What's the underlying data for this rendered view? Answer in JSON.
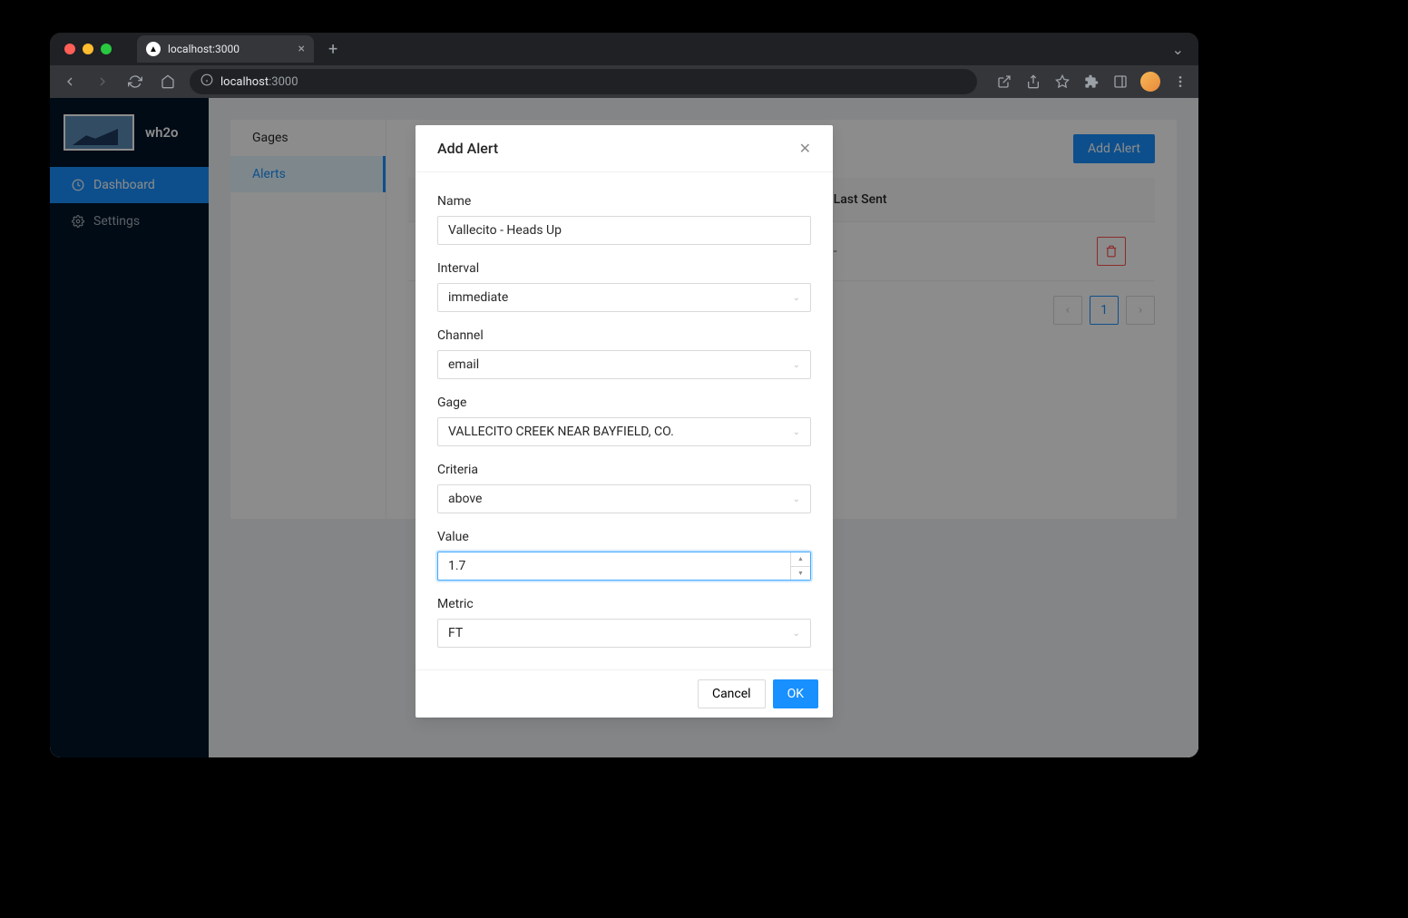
{
  "browser": {
    "tab_title": "localhost:3000",
    "url_prefix": "localhost",
    "url_suffix": ":3000"
  },
  "sidebar": {
    "app_name": "wh2o",
    "items": [
      {
        "label": "Dashboard"
      },
      {
        "label": "Settings"
      }
    ]
  },
  "tabs": {
    "items": [
      {
        "label": "Gages"
      },
      {
        "label": "Alerts"
      }
    ]
  },
  "panel": {
    "add_button": "Add Alert",
    "columns": {
      "last_sent": "Last Sent"
    },
    "rows": [
      {
        "last_sent": "-"
      }
    ],
    "page": "1"
  },
  "modal": {
    "title": "Add Alert",
    "fields": {
      "name": {
        "label": "Name",
        "value": "Vallecito - Heads Up"
      },
      "interval": {
        "label": "Interval",
        "value": "immediate"
      },
      "channel": {
        "label": "Channel",
        "value": "email"
      },
      "gage": {
        "label": "Gage",
        "value": "VALLECITO CREEK NEAR BAYFIELD, CO."
      },
      "criteria": {
        "label": "Criteria",
        "value": "above"
      },
      "value": {
        "label": "Value",
        "value": "1.7"
      },
      "metric": {
        "label": "Metric",
        "value": "FT"
      }
    },
    "cancel": "Cancel",
    "ok": "OK"
  }
}
